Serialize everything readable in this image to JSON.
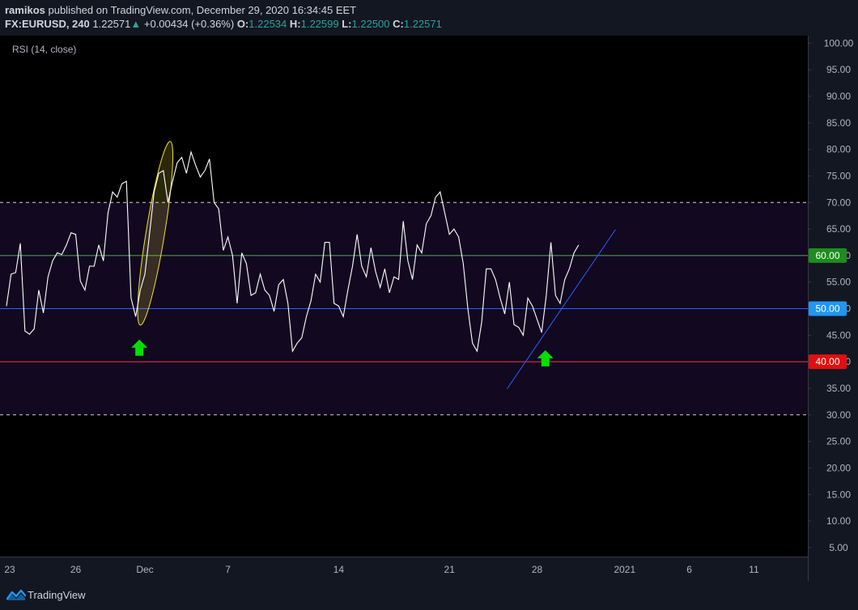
{
  "header": {
    "author": "ramikos",
    "published": " published on TradingView.com, December 29, 2020 16:34:45 EET",
    "symbol": "FX:EURUSD, 240",
    "price": "1.22571",
    "change": "+0.00434 (+0.36%)",
    "o_label": "O:",
    "o_value": "1.22534",
    "h_label": "H:",
    "h_value": "1.22599",
    "l_label": "L:",
    "l_value": "1.22500",
    "c_label": "C:",
    "c_value": "1.22571"
  },
  "footer": {
    "brand": "TradingView"
  },
  "colors": {
    "background": "#000000",
    "band": "#120820",
    "rsi_line": "#ffffff",
    "line_60": "#4caf50",
    "line_50": "#2962ff",
    "line_40": "#f23645",
    "trendline": "#2962ff",
    "ellipse": "#f0e030",
    "arrow": "#00e000",
    "label_50": "#2196f3",
    "label_60": "#1e8c1e",
    "label_40": "#e01010"
  },
  "chart_data": {
    "type": "line",
    "indicator": "RSI (14, close)",
    "ylim": [
      0,
      100
    ],
    "y_ticks": [
      "100.00",
      "95.00",
      "90.00",
      "85.00",
      "80.00",
      "75.00",
      "70.00",
      "65.00",
      "60.00",
      "55.00",
      "50.00",
      "45.00",
      "40.00",
      "35.00",
      "30.00",
      "25.00",
      "20.00",
      "15.00",
      "10.00",
      "5.00"
    ],
    "x_tick_labels": [
      "23",
      "26",
      "Dec",
      "7",
      "14",
      "21",
      "28",
      "2021",
      "6",
      "11"
    ],
    "x_ticks": [
      {
        "label": "23",
        "i": 0
      },
      {
        "label": "26",
        "i": 15
      },
      {
        "label": "Dec",
        "i": 30
      },
      {
        "label": "7",
        "i": 48
      },
      {
        "label": "14",
        "i": 72
      },
      {
        "label": "21",
        "i": 96
      },
      {
        "label": "28",
        "i": 115
      },
      {
        "label": "2021",
        "i": 134
      },
      {
        "label": "6",
        "i": 148
      },
      {
        "label": "11",
        "i": 162
      }
    ],
    "x_max_index": 168,
    "band": [
      30,
      70
    ],
    "dashed_levels": [
      70,
      30
    ],
    "levels": [
      {
        "value": 60,
        "label": "60.00",
        "color_key": "line_60"
      },
      {
        "value": 50,
        "label": "50.00",
        "color_key": "line_50"
      },
      {
        "value": 40,
        "label": "40.00",
        "color_key": "line_40"
      }
    ],
    "series": [
      {
        "values": [
          50.5,
          56.5,
          56.8,
          62.3,
          45.8,
          45.2,
          46.2,
          53.5,
          49.2,
          56,
          59,
          60.5,
          60.2,
          62,
          64.3,
          64,
          55.2,
          53.5,
          58,
          58,
          62,
          59,
          68,
          72,
          71,
          73.5,
          74,
          52,
          48.5,
          53.5,
          56.5,
          64,
          72,
          75.5,
          76,
          70,
          74,
          77.5,
          78.5,
          75.5,
          79.5,
          77,
          74.8,
          76,
          78.2,
          70,
          68.8,
          61,
          63.5,
          60,
          51,
          60.5,
          58.5,
          52.5,
          53,
          56.5,
          53.5,
          52.5,
          49.5,
          54.5,
          55.5,
          51,
          42,
          43.5,
          44.5,
          48.5,
          51.5,
          56.5,
          55,
          62.5,
          62.5,
          51,
          50.5,
          48.5,
          53.5,
          58,
          64,
          58,
          56,
          61.5,
          57,
          54,
          57.5,
          53,
          56,
          55.5,
          66.5,
          59,
          55.5,
          62,
          60.5,
          66,
          67.5,
          71,
          72,
          68,
          64,
          65,
          63.5,
          58.5,
          50,
          43.5,
          42,
          47.5,
          57.5,
          57.5,
          55.5,
          52,
          49,
          55,
          47,
          46.5,
          45,
          52,
          50.5,
          48,
          45.5,
          52.5,
          62.5,
          52.5,
          51,
          55.5,
          57.5,
          60.5,
          62
        ]
      }
    ],
    "annotations": [
      {
        "type": "trendline",
        "from": {
          "i": 108.5,
          "y": 34.9
        },
        "to": {
          "i": 132,
          "y": 64.9
        }
      },
      {
        "type": "ellipse",
        "from": {
          "i": 29,
          "y": 46.9
        },
        "to": {
          "i": 35.5,
          "y": 81.5
        }
      },
      {
        "type": "arrow_up",
        "at": {
          "i": 28.8,
          "y": 42.5
        }
      },
      {
        "type": "arrow_up",
        "at": {
          "i": 116.8,
          "y": 40.5
        }
      }
    ]
  }
}
